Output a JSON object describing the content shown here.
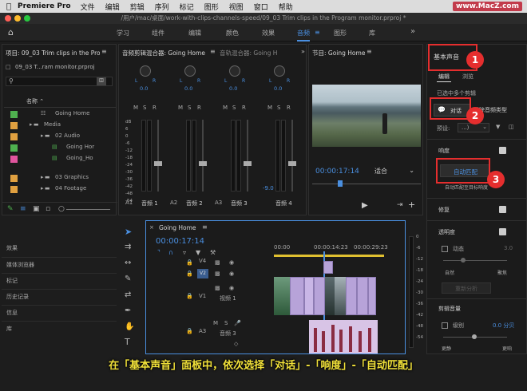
{
  "menubar": {
    "apple": "",
    "app": "Premiere Pro",
    "items": [
      "文件",
      "编辑",
      "剪辑",
      "序列",
      "标记",
      "图形",
      "视图",
      "窗口",
      "帮助"
    ],
    "watermark": "www.MacZ.com"
  },
  "titlebar": {
    "path": "/用户/mac/桌面/work-with-clips-channels-speed/09_03 Trim clips in the Program monitor.prproj *"
  },
  "workspace": {
    "tabs": [
      "学习",
      "组件",
      "编辑",
      "颜色",
      "效果",
      "音频",
      "图形",
      "库"
    ],
    "active": "音频",
    "more": "»"
  },
  "project": {
    "title": "项目: 09_03 Trim clips in the Proj",
    "file": "09_03 T...ram monitor.prproj",
    "column": "名称",
    "items": [
      {
        "name": "Going Home",
        "color": "#4fb14f",
        "indent": 1
      },
      {
        "name": "Media",
        "color": "#e0a040",
        "indent": 0
      },
      {
        "name": "02 Audio",
        "color": "#e0a040",
        "indent": 1
      },
      {
        "name": "Going Hor",
        "color": "#4fb14f",
        "indent": 2
      },
      {
        "name": "Going_Ho",
        "color": "#e0559e",
        "indent": 2
      },
      {
        "name": "03 Graphics",
        "color": "#e0a040",
        "indent": 1
      },
      {
        "name": "04 Footage",
        "color": "#e0a040",
        "indent": 1
      }
    ]
  },
  "left_nav": {
    "items": [
      "效果",
      "媒体浏览器",
      "标记",
      "历史记录",
      "信息",
      "库"
    ]
  },
  "mixer": {
    "title": "音频剪辑混合器: Going Home",
    "title2": "音轨混合器: Going H",
    "channels": [
      {
        "a": "A1",
        "name": "音频 1"
      },
      {
        "a": "A2",
        "name": "音频 2"
      },
      {
        "a": "A3",
        "name": "音频 3"
      },
      {
        "a": "",
        "name": "音频 4"
      }
    ],
    "value": "0.0",
    "lr": "L",
    "rr": "R",
    "db_ticks": [
      "dB",
      "6",
      "0",
      "-6",
      "-12",
      "-18",
      "-24",
      "-30",
      "-36",
      "-42",
      "-48",
      "-54"
    ],
    "level": "-9.0",
    "msr": [
      "M",
      "S",
      "R"
    ]
  },
  "program": {
    "title": "节目: Going Home",
    "timecode": "00:00:17:14",
    "fit": "适合",
    "play": "▶"
  },
  "timeline": {
    "title": "Going Home",
    "timecode": "00:00:17:14",
    "ruler": [
      "00:00",
      "00:00:14:23",
      "00:00:29:23"
    ],
    "tracks": [
      {
        "id": "V4",
        "name": ""
      },
      {
        "id": "V2",
        "name": ""
      },
      {
        "id": "V1",
        "name": "视频 1"
      },
      {
        "id": "A3",
        "name": "音频 3"
      }
    ],
    "meter_ticks": [
      "0",
      "-6",
      "-12",
      "-18",
      "-24",
      "-30",
      "-36",
      "-42",
      "-48",
      "-54"
    ]
  },
  "essential_sound": {
    "title": "基本声音",
    "tabs": [
      "编辑",
      "浏览"
    ],
    "selected": "已选中多个剪辑",
    "dialogue": "对话",
    "clear_type": "清除音频类型",
    "preset_label": "预设:",
    "preset_value": "...)",
    "loudness": "响度",
    "auto_match": "自动匹配",
    "auto_match_note": "自动匹配至目标响度",
    "repair": "修复",
    "clarity": "透明度",
    "dynamics": "动态",
    "dyn_value": "3.0",
    "natural": "自然",
    "focused": "聚焦",
    "reset": "重新分析",
    "clip_volume": "剪辑音量",
    "level": "级别",
    "level_value": "0.0 分贝",
    "lower": "更静",
    "louder": "更响",
    "mute": "静音"
  },
  "annotations": {
    "b1": "1",
    "b2": "2",
    "b3": "3"
  },
  "caption": "在「基本声音」面板中，依次选择「对话」-「响度」-「自动匹配」",
  "colors": {
    "accent": "#4a8fe0",
    "annot": "#e52e2e",
    "caption": "#f2e23a"
  }
}
